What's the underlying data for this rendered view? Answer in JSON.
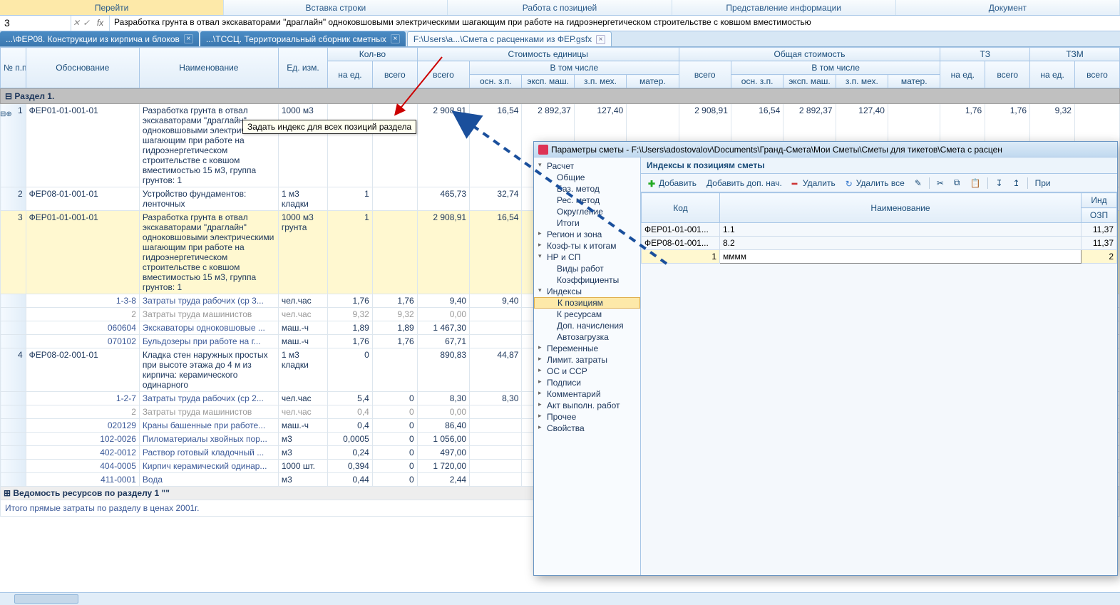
{
  "menu": {
    "goto": "Перейти",
    "insert": "Вставка строки",
    "item": "Работа с позицией",
    "view": "Представление информации",
    "doc": "Документ"
  },
  "formula": {
    "ref": "3",
    "fx_x": "✕",
    "fx_chk": "✓",
    "fx": "fx",
    "text": "Разработка грунта в отвал экскаваторами \"драглайн\" одноковшовыми электрическими шагающим при работе на гидроэнергетическом строительстве с ковшом вместимостью"
  },
  "tabs": [
    {
      "label": "...\\ФЕР08. Конструкции из кирпича и блоков",
      "active": false
    },
    {
      "label": "...\\ТССЦ. Территориальный сборник сметных",
      "active": false
    },
    {
      "label": "F:\\Users\\a...\\Смета с расценками из ФЕР.gsfx",
      "active": true
    }
  ],
  "gridHeader": {
    "num": "№\nп.п",
    "osn": "Обоснование",
    "naim": "Наименование",
    "ed": "Ед. изм.",
    "kolvo": "Кол-во",
    "na_ed": "на ед.",
    "vsego": "всего",
    "stoim_ed": "Стоимость единицы",
    "vtom": "В том числе",
    "osn_zp": "осн. з.п.",
    "eksp": "эксп. маш.",
    "zp_mex": "з.п. мех.",
    "mater": "матер.",
    "obsh": "Общая стоимость",
    "t3": "ТЗ",
    "t3m": "ТЗМ"
  },
  "section": "Раздел 1.",
  "rows": [
    {
      "n": "1",
      "osn": "ФЕР01-01-001-01",
      "naim": "Разработка грунта в отвал экскаваторами \"драглайн\" одноковшовыми электрическими шагающим при работе на гидроэнергетическом строительстве с ковшом вместимостью 15 м3, группа грунтов: 1",
      "ed": "1000 м3",
      "vsego": "2 908,91",
      "osn_zp": "16,54",
      "eksp": "2 892,37",
      "zp_mex": "127,40",
      "o_vsego": "2 908,91",
      "o_osn": "16,54",
      "o_eksp": "2 892,37",
      "o_zp": "127,40",
      "t3_ed": "1,76",
      "t3_vs": "1,76",
      "t3m_ed": "9,32"
    },
    {
      "n": "2",
      "osn": "ФЕР08-01-001-01",
      "naim": "Устройство фундаментов: ленточных",
      "ed": "1 м3 кладки",
      "na_ed": "1",
      "vsego": "465,73",
      "osn_zp": "32,74"
    },
    {
      "n": "3",
      "osn": "ФЕР01-01-001-01",
      "naim": "Разработка грунта в отвал экскаваторами \"драглайн\" одноковшовыми электрическими шагающим при работе на гидроэнергетическом строительстве с ковшом вместимостью 15 м3, группа грунтов: 1",
      "ed": "1000 м3 грунта",
      "na_ed": "1",
      "vsego": "2 908,91",
      "osn_zp": "16,54",
      "hl": true,
      "clip": true
    },
    {
      "osn": "1-3-8",
      "naim": "Затраты труда рабочих (ср 3...",
      "ed": "чел.час",
      "na_ed": "1,76",
      "vs": "1,76",
      "vsego": "9,40",
      "osn_zp": "9,40",
      "sub": true
    },
    {
      "osn": "2",
      "naim": "Затраты труда машинистов",
      "ed": "чел.час",
      "na_ed": "9,32",
      "vs": "9,32",
      "vsego": "0,00",
      "sub": true,
      "gray": true
    },
    {
      "osn": "060604",
      "naim": "Экскаваторы одноковшовые ...",
      "ed": "маш.-ч",
      "na_ed": "1,89",
      "vs": "1,89",
      "vsego": "1 467,30",
      "sub": true
    },
    {
      "osn": "070102",
      "naim": "Бульдозеры при работе на г...",
      "ed": "маш.-ч",
      "na_ed": "1,76",
      "vs": "1,76",
      "vsego": "67,71",
      "sub": true
    },
    {
      "n": "4",
      "osn": "ФЕР08-02-001-01",
      "naim": "Кладка стен наружных простых при высоте этажа до 4 м из кирпича: керамического одинарного",
      "ed": "1 м3 кладки",
      "na_ed": "0",
      "vsego": "890,83",
      "osn_zp": "44,87"
    },
    {
      "osn": "1-2-7",
      "naim": "Затраты труда рабочих (ср 2...",
      "ed": "чел.час",
      "na_ed": "5,4",
      "vs": "0",
      "vsego": "8,30",
      "osn_zp": "8,30",
      "sub": true
    },
    {
      "osn": "2",
      "naim": "Затраты труда машинистов",
      "ed": "чел.час",
      "na_ed": "0,4",
      "vs": "0",
      "vsego": "0,00",
      "sub": true,
      "gray": true
    },
    {
      "osn": "020129",
      "naim": "Краны башенные при работе...",
      "ed": "маш.-ч",
      "na_ed": "0,4",
      "vs": "0",
      "vsego": "86,40",
      "sub": true
    },
    {
      "osn": "102-0026",
      "naim": "Пиломатериалы хвойных пор...",
      "ed": "м3",
      "na_ed": "0,0005",
      "vs": "0",
      "vsego": "1 056,00",
      "sub": true
    },
    {
      "osn": "402-0012",
      "naim": "Раствор готовый кладочный ...",
      "ed": "м3",
      "na_ed": "0,24",
      "vs": "0",
      "vsego": "497,00",
      "sub": true
    },
    {
      "osn": "404-0005",
      "naim": "Кирпич керамический одинар...",
      "ed": "1000 шт.",
      "na_ed": "0,394",
      "vs": "0",
      "vsego": "1 720,00",
      "sub": true
    },
    {
      "osn": "411-0001",
      "naim": "Вода",
      "ed": "м3",
      "na_ed": "0,44",
      "vs": "0",
      "vsego": "2,44",
      "sub": true
    }
  ],
  "summary": "Ведомость ресурсов по разделу 1 \"\"",
  "itogo": "Итого прямые затраты по разделу в ценах 2001г.",
  "tooltip": "Задать индекс для всех позиций раздела",
  "dialog": {
    "title": "Параметры сметы - F:\\Users\\adostovalov\\Documents\\Гранд-Смета\\Мои Сметы\\Сметы для тикетов\\Смета с расцен",
    "tree": [
      {
        "t": "Расчет",
        "l": 1,
        "exp": true
      },
      {
        "t": "Общие",
        "l": 2
      },
      {
        "t": "Баз. метод",
        "l": 2
      },
      {
        "t": "Рес. метод",
        "l": 2
      },
      {
        "t": "Округление",
        "l": 2
      },
      {
        "t": "Итоги",
        "l": 2
      },
      {
        "t": "Регион и зона",
        "l": 1
      },
      {
        "t": "Коэф-ты к итогам",
        "l": 1
      },
      {
        "t": "НР и СП",
        "l": 1,
        "exp": true
      },
      {
        "t": "Виды работ",
        "l": 2
      },
      {
        "t": "Коэффициенты",
        "l": 2
      },
      {
        "t": "Индексы",
        "l": 1,
        "exp": true
      },
      {
        "t": "К позициям",
        "l": 2,
        "sel": true
      },
      {
        "t": "К ресурсам",
        "l": 2
      },
      {
        "t": "Доп. начисления",
        "l": 2
      },
      {
        "t": "Автозагрузка",
        "l": 2
      },
      {
        "t": "Переменные",
        "l": 1
      },
      {
        "t": "Лимит. затраты",
        "l": 1
      },
      {
        "t": "ОС и ССР",
        "l": 1
      },
      {
        "t": "Подписи",
        "l": 1
      },
      {
        "t": "Комментарий",
        "l": 1
      },
      {
        "t": "Акт выполн. работ",
        "l": 1
      },
      {
        "t": "Прочее",
        "l": 1
      },
      {
        "t": "Свойства",
        "l": 1
      }
    ],
    "paneTitle": "Индексы к позициям сметы",
    "toolbar": {
      "add": "Добавить",
      "addDop": "Добавить доп. нач.",
      "del": "Удалить",
      "delAll": "Удалить все",
      "apply": "При"
    },
    "idxHeader": {
      "kod": "Код",
      "naim": "Наименование",
      "ind": "Инд",
      "ozp": "ОЗП"
    },
    "idxRows": [
      {
        "kod": "ФЕР01-01-001...",
        "naim": "1.1",
        "val": "11,37"
      },
      {
        "kod": "ФЕР08-01-001...",
        "naim": "8.2",
        "val": "11,37"
      },
      {
        "kod": "1",
        "naim": "мммм",
        "val": "2",
        "edit": true
      }
    ]
  }
}
